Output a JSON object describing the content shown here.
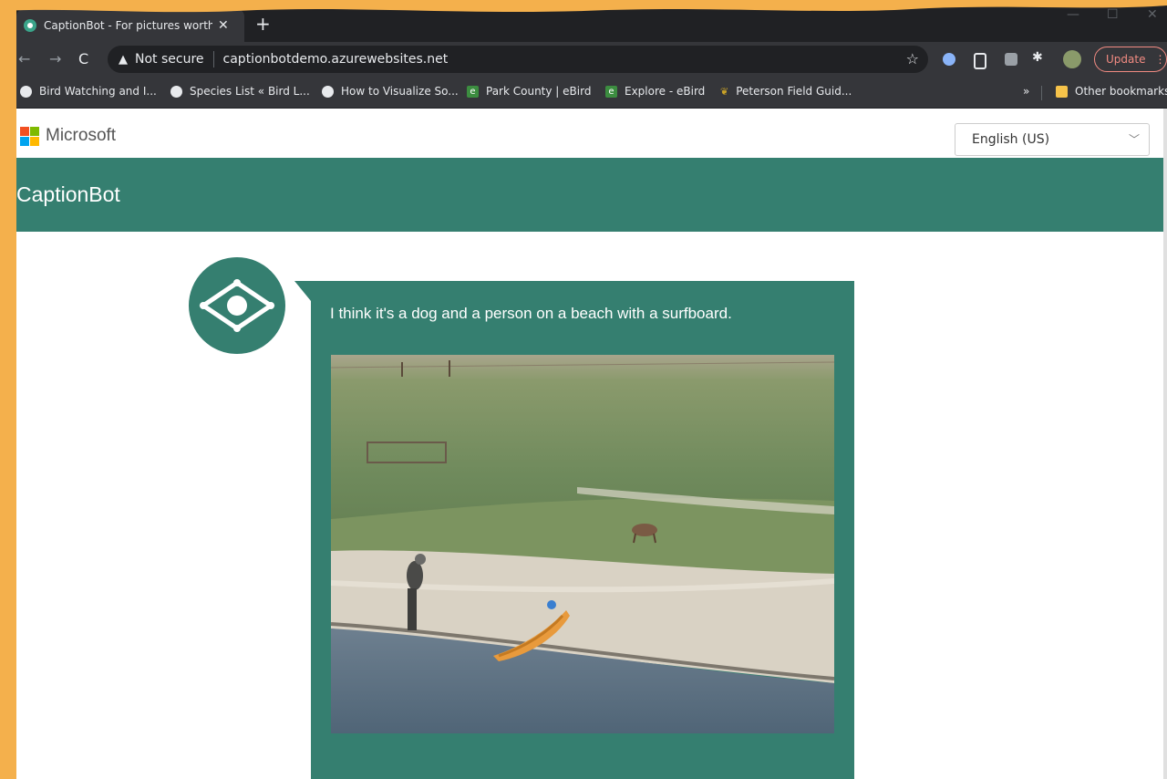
{
  "browser": {
    "tab_title": "CaptionBot - For pictures worth t",
    "tab_close": "✕",
    "new_tab": "+",
    "address": {
      "security_label": "Not secure",
      "url": "captionbotdemo.azurewebsites.net"
    },
    "update_label": "Update",
    "bookmarks": [
      {
        "label": "Bird Watching and I...",
        "icon": "globe-icon"
      },
      {
        "label": "Species List « Bird L...",
        "icon": "globe-icon"
      },
      {
        "label": "How to Visualize So...",
        "icon": "globe-icon"
      },
      {
        "label": "Park County | eBird",
        "icon": "ebird-icon"
      },
      {
        "label": "Explore - eBird",
        "icon": "ebird-icon"
      },
      {
        "label": "Peterson Field Guid...",
        "icon": "peterson-icon"
      }
    ],
    "bookmarks_overflow": "»",
    "other_bookmarks": "Other bookmarks"
  },
  "page": {
    "brand": "Microsoft",
    "language_select": "English (US)",
    "app_name": "CaptionBot",
    "caption": "I think it's a dog and a person on a beach with a surfboard.",
    "photo_description": "river bank with person, dog and orange kayak"
  },
  "colors": {
    "brand_green": "#357f70",
    "frame_orange": "#f4b04c",
    "chrome_dark": "#35363a"
  }
}
